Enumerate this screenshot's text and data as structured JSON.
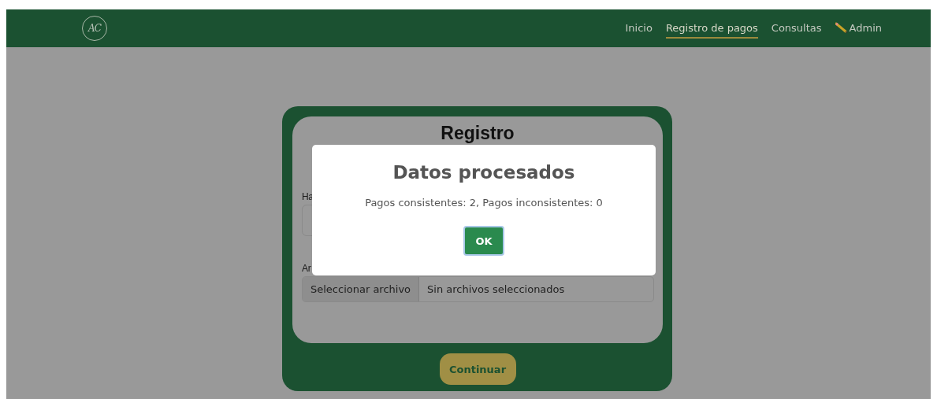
{
  "navbar": {
    "logo": "AC",
    "links": [
      {
        "label": "Inicio",
        "selected": false
      },
      {
        "label": "Registro de pagos",
        "selected": true
      },
      {
        "label": "Consultas",
        "selected": false
      },
      {
        "label": "Admin",
        "selected": false,
        "kind": "admin"
      }
    ]
  },
  "form": {
    "title": "Registro",
    "fields": [
      {
        "kind": "text",
        "label": "Ha"
      },
      {
        "kind": "file",
        "label": "Ar",
        "button": "Seleccionar archivo",
        "value": "Sin archivos seleccionados"
      }
    ],
    "submit": "Continuar"
  },
  "modal": {
    "title": "Datos procesados",
    "message": "Pagos consistentes: 2, Pagos inconsistentes: 0",
    "button": "OK"
  }
}
